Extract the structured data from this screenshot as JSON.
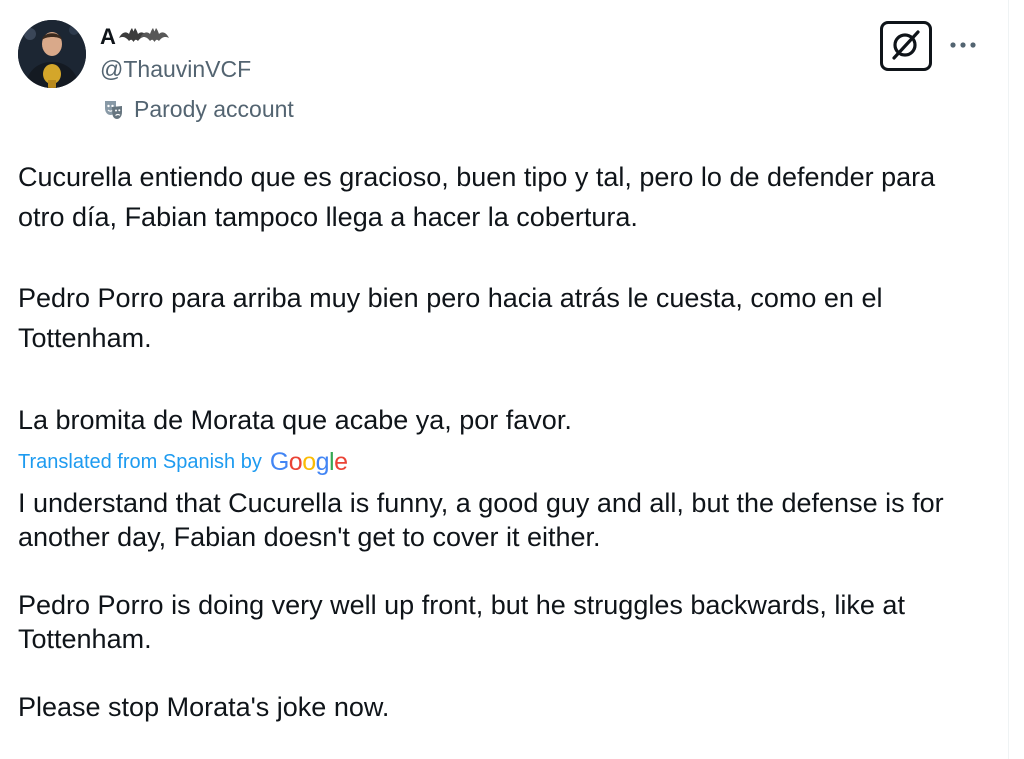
{
  "author": {
    "display_name": "A",
    "handle": "@ThauvinVCF",
    "label": "Parody account"
  },
  "icons": {
    "avatar": "avatar",
    "name_emoji": "bat-emoji-icon",
    "parody": "theater-mask-icon",
    "grok": "grok-icon",
    "more": "more-options-icon"
  },
  "original": {
    "paragraphs": [
      "Cucurella entiendo que es gracioso, buen tipo y tal, pero lo de defender para otro día, Fabian tampoco llega a hacer la cobertura.",
      "Pedro Porro para arriba muy bien pero hacia atrás le cuesta, como en el Tottenham.",
      "La bromita de Morata que acabe ya, por favor."
    ]
  },
  "translation": {
    "label": "Translated from Spanish by",
    "provider_letters": [
      "G",
      "o",
      "o",
      "g",
      "l",
      "e"
    ],
    "provider_colors": [
      "#4285f4",
      "#ea4335",
      "#fbbc05",
      "#4285f4",
      "#34a853",
      "#ea4335"
    ],
    "paragraphs": [
      "I understand that Cucurella is funny, a good guy and all, but the defense is for another day, Fabian doesn't get to cover it either.",
      "Pedro Porro is doing very well up front, but he struggles backwards, like at Tottenham.",
      "Please stop Morata's joke now."
    ]
  },
  "colors": {
    "text": "#0f1419",
    "secondary": "#536471",
    "link": "#1d9bf0"
  }
}
